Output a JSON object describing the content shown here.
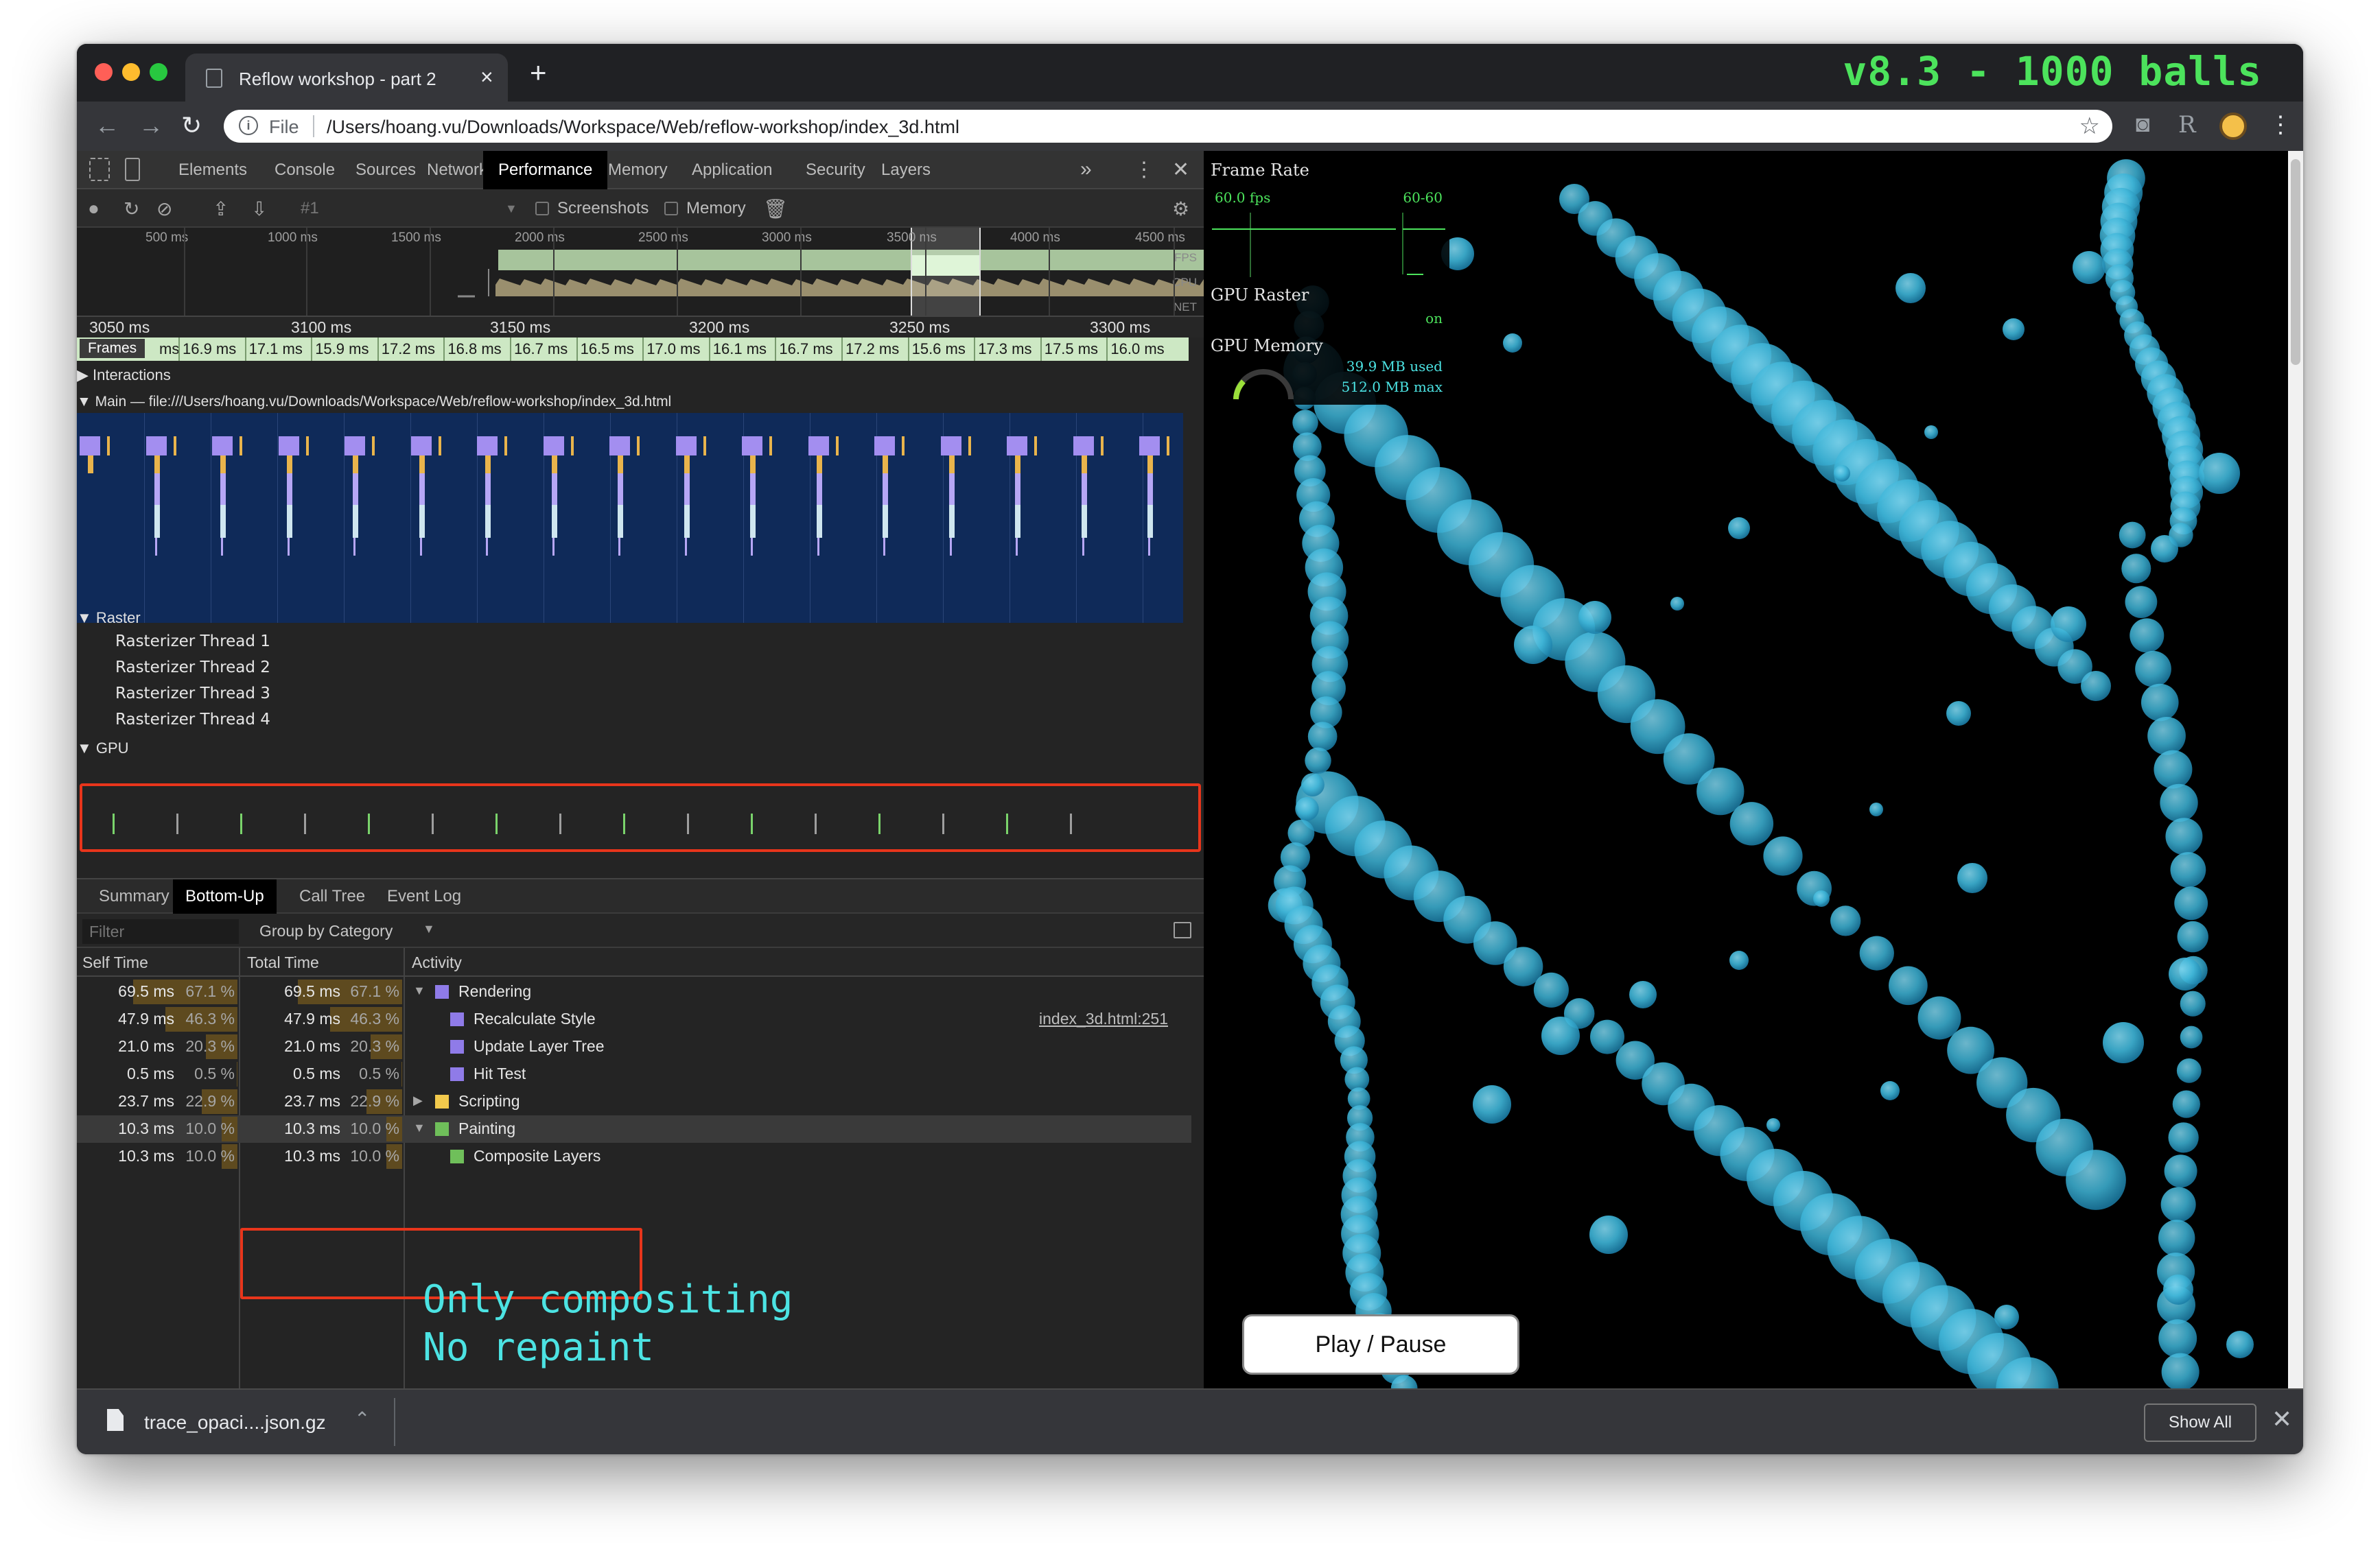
{
  "browser": {
    "tab_title": "Reflow workshop - part 2",
    "tab_close": "×",
    "new_tab": "+",
    "banner": "v8.3 - 1000 balls",
    "omnibox": {
      "scheme_label": "File",
      "url": "/Users/hoang.vu/Downloads/Workspace/Web/reflow-workshop/index_3d.html"
    }
  },
  "devtools": {
    "tabs": [
      "Elements",
      "Console",
      "Sources",
      "Network",
      "Performance",
      "Memory",
      "Application",
      "Security",
      "Layers"
    ],
    "active_tab": "Performance",
    "more": "»",
    "close": "✕",
    "kebab": "⋮",
    "recording": {
      "profile_label": "#1",
      "screenshots_label": "Screenshots",
      "memory_label": "Memory"
    },
    "overview_ticks": [
      "500 ms",
      "1000 ms",
      "1500 ms",
      "2000 ms",
      "2500 ms",
      "3000 ms",
      "3500 ms",
      "4000 ms",
      "4500 ms"
    ],
    "overview_labels": {
      "fps": "FPS",
      "cpu": "CPU",
      "net": "NET"
    },
    "ruler": [
      "3050 ms",
      "3100 ms",
      "3150 ms",
      "3200 ms",
      "3250 ms",
      "3300 ms"
    ],
    "frames": {
      "label": "Frames",
      "leading": "ms",
      "values": [
        "16.9 ms",
        "17.1 ms",
        "15.9 ms",
        "17.2 ms",
        "16.8 ms",
        "16.7 ms",
        "16.5 ms",
        "17.0 ms",
        "16.1 ms",
        "16.7 ms",
        "17.2 ms",
        "15.6 ms",
        "17.3 ms",
        "17.5 ms",
        "16.0 ms"
      ]
    },
    "tracks": {
      "interactions": "Interactions",
      "main": "Main — file:///Users/hoang.vu/Downloads/Workspace/Web/reflow-workshop/index_3d.html",
      "raster": "Raster",
      "rasterizers": [
        "Rasterizer Thread 1",
        "Rasterizer Thread 2",
        "Rasterizer Thread 3",
        "Rasterizer Thread 4"
      ],
      "gpu": "GPU"
    },
    "bottom_tabs": [
      "Summary",
      "Bottom-Up",
      "Call Tree",
      "Event Log"
    ],
    "active_bottom_tab": "Bottom-Up",
    "filter_placeholder": "Filter",
    "group_by": "Group by Category",
    "columns": {
      "self_time": "Self Time",
      "total_time": "Total Time",
      "activity": "Activity"
    },
    "rows": [
      {
        "self": "69.5 ms",
        "self_pct": "67.1 %",
        "total": "69.5 ms",
        "total_pct": "67.1 %",
        "activity": "Rendering",
        "toggle": "▼",
        "color": "#8f7be8",
        "self_frac": 0.671,
        "total_frac": 0.671,
        "source": ""
      },
      {
        "self": "47.9 ms",
        "self_pct": "46.3 %",
        "total": "47.9 ms",
        "total_pct": "46.3 %",
        "activity": "Recalculate Style",
        "toggle": "",
        "color": "#8f7be8",
        "self_frac": 0.463,
        "total_frac": 0.463,
        "source": "index_3d.html:251"
      },
      {
        "self": "21.0 ms",
        "self_pct": "20.3 %",
        "total": "21.0 ms",
        "total_pct": "20.3 %",
        "activity": "Update Layer Tree",
        "toggle": "",
        "color": "#8f7be8",
        "self_frac": 0.203,
        "total_frac": 0.203,
        "source": ""
      },
      {
        "self": "0.5 ms",
        "self_pct": "0.5 %",
        "total": "0.5 ms",
        "total_pct": "0.5 %",
        "activity": "Hit Test",
        "toggle": "",
        "color": "#8f7be8",
        "self_frac": 0.005,
        "total_frac": 0.005,
        "source": ""
      },
      {
        "self": "23.7 ms",
        "self_pct": "22.9 %",
        "total": "23.7 ms",
        "total_pct": "22.9 %",
        "activity": "Scripting",
        "toggle": "▶",
        "color": "#f2c94c",
        "self_frac": 0.229,
        "total_frac": 0.229,
        "source": ""
      },
      {
        "self": "10.3 ms",
        "self_pct": "10.0 %",
        "total": "10.3 ms",
        "total_pct": "10.0 %",
        "activity": "Painting",
        "toggle": "▼",
        "color": "#6fbf5a",
        "self_frac": 0.1,
        "total_frac": 0.1,
        "source": ""
      },
      {
        "self": "10.3 ms",
        "self_pct": "10.0 %",
        "total": "10.3 ms",
        "total_pct": "10.0 %",
        "activity": "Composite Layers",
        "toggle": "",
        "color": "#6fbf5a",
        "self_frac": 0.1,
        "total_frac": 0.1,
        "source": ""
      }
    ],
    "selected_row": 5,
    "annotation": "Only compositing\nNo repaint"
  },
  "page": {
    "stats": {
      "frame_rate_title": "Frame Rate",
      "fps_value": "60.0 fps",
      "fps_range": "60-60",
      "gpu_raster_title": "GPU Raster",
      "gpu_raster_state": "on",
      "gpu_memory_title": "GPU Memory",
      "gpu_memory_used": "39.9 MB used",
      "gpu_memory_max": "512.0 MB max"
    },
    "play_button": "Play / Pause"
  },
  "downloads": {
    "file": "trace_opaci....json.gz",
    "show_all": "Show All",
    "close": "✕"
  },
  "colors": {
    "accent_green": "#4ce35c",
    "accent_cyan": "#4ce3e3",
    "ball": "#3fb6d9",
    "highlight_red": "#e8351b",
    "flame_bg": "#0f2a59"
  },
  "icons": [
    "info-icon",
    "star-icon",
    "camera-icon",
    "reload-icon",
    "record-icon",
    "clear-icon",
    "upload-icon",
    "download-icon",
    "trash-icon",
    "gear-icon",
    "file-icon",
    "chevron-up-icon"
  ]
}
